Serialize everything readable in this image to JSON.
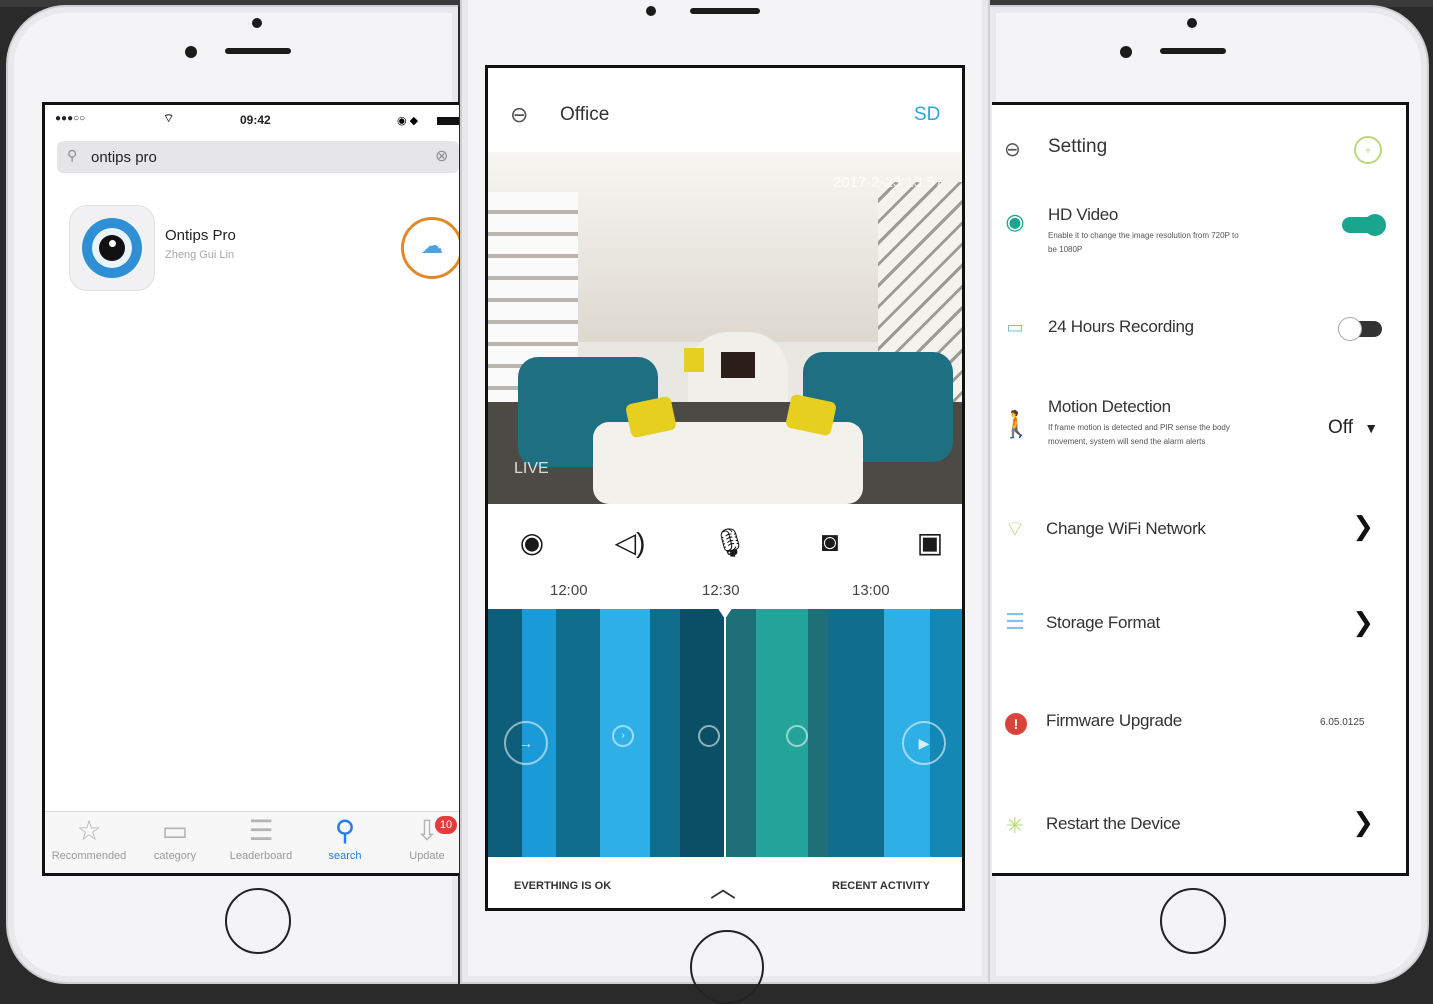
{
  "colors": {
    "accent_blue": "#2a7be6",
    "teal": "#1aa58e",
    "orange_ring": "#e08a2c",
    "red_badge": "#e23c3c",
    "timeline": [
      "#0c5e7a",
      "#1b9ad8",
      "#116d8c",
      "#2eb0e6",
      "#0a4f66",
      "#1e6f78",
      "#23a39a",
      "#1388b5"
    ]
  },
  "left_phone": {
    "status_bar": {
      "signal": "●●●○○",
      "wifi": "wifi-icon",
      "time": "09:42"
    },
    "search": {
      "value": "ontips pro",
      "icon": "search-icon",
      "clear_icon": "clear-icon"
    },
    "app": {
      "name": "Ontips Pro",
      "developer": "Zheng Gui Lin",
      "action_icon": "cloud-download-icon"
    },
    "tabs": [
      {
        "label": "Recommended",
        "icon": "star-icon"
      },
      {
        "label": "category",
        "icon": "category-icon"
      },
      {
        "label": "Leaderboard",
        "icon": "list-icon"
      },
      {
        "label": "search",
        "icon": "search-icon",
        "active": true
      },
      {
        "label": "Update",
        "icon": "update-icon",
        "badge": "10"
      }
    ]
  },
  "middle_phone": {
    "header": {
      "back_icon": "back-icon",
      "title": "Office",
      "quality": "SD"
    },
    "video": {
      "timestamp": "2017-2-23 13:57",
      "live_label": "LIVE"
    },
    "controls": [
      {
        "name": "eye-icon",
        "glyph": "👁"
      },
      {
        "name": "speaker-icon",
        "glyph": "🔊"
      },
      {
        "name": "microphone-icon",
        "glyph": "🎙"
      },
      {
        "name": "camera-icon",
        "glyph": "📷"
      },
      {
        "name": "playback-icon",
        "glyph": "▶"
      }
    ],
    "timeline_labels": [
      "12:00",
      "12:30",
      "13:00"
    ],
    "footer": {
      "left": "EVERTHING IS OK",
      "center_icon": "chevron-up-icon",
      "right": "RECENT ACTIVITY"
    }
  },
  "right_phone": {
    "header": {
      "back_icon": "back-icon",
      "title": "Setting",
      "info_icon": "info-icon"
    },
    "items": [
      {
        "title": "HD Video",
        "desc": "Enable it to change the image resolution from 720P to be 1080P",
        "icon": "lens-icon",
        "control": "toggle-on"
      },
      {
        "title": "24 Hours Recording",
        "desc": "",
        "icon": "recording-icon",
        "control": "toggle-off"
      },
      {
        "title": "Motion Detection",
        "desc": "If frame motion is detected and PIR sense the body movement, system will send the alarm alerts",
        "icon": "person-walking-icon",
        "control": "select",
        "value": "Off"
      },
      {
        "title": "Change WiFi Network",
        "desc": "",
        "icon": "wifi-icon",
        "control": "chevron"
      },
      {
        "title": "Storage Format",
        "desc": "",
        "icon": "database-icon",
        "control": "chevron"
      },
      {
        "title": "Firmware Upgrade",
        "desc": "",
        "icon": "alert-icon",
        "control": "value",
        "value": "6.05.0125"
      },
      {
        "title": "Restart the Device",
        "desc": "",
        "icon": "loading-icon",
        "control": "chevron"
      }
    ]
  }
}
